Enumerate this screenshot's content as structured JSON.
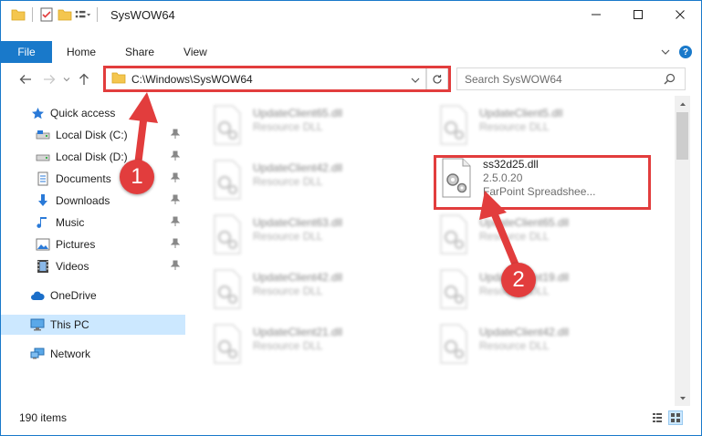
{
  "window": {
    "title": "SysWOW64",
    "controls": {
      "minimize": "─",
      "maximize": "☐",
      "close": "✕"
    }
  },
  "ribbon": {
    "tabs": [
      {
        "label": "File",
        "active": true
      },
      {
        "label": "Home"
      },
      {
        "label": "Share"
      },
      {
        "label": "View"
      }
    ],
    "help_label": "?"
  },
  "addressbar": {
    "path": "C:\\Windows\\SysWOW64",
    "search_placeholder": "Search SysWOW64"
  },
  "navpane": {
    "items": [
      {
        "label": "Quick access",
        "icon": "star-icon",
        "pinned": false
      },
      {
        "label": "Local Disk (C:)",
        "icon": "drive-icon",
        "pinned": true
      },
      {
        "label": "Local Disk (D:)",
        "icon": "drive-icon",
        "pinned": true
      },
      {
        "label": "Documents",
        "icon": "documents-icon",
        "pinned": true
      },
      {
        "label": "Downloads",
        "icon": "downloads-icon",
        "pinned": true
      },
      {
        "label": "Music",
        "icon": "music-icon",
        "pinned": true
      },
      {
        "label": "Pictures",
        "icon": "pictures-icon",
        "pinned": true
      },
      {
        "label": "Videos",
        "icon": "videos-icon",
        "pinned": true
      },
      {
        "label": "OneDrive",
        "icon": "cloud-icon",
        "pinned": false
      },
      {
        "label": "This PC",
        "icon": "computer-icon",
        "pinned": false,
        "selected": true
      },
      {
        "label": "Network",
        "icon": "network-icon",
        "pinned": false
      }
    ]
  },
  "files": [
    {
      "name": "UpdateClient65.dll",
      "type": "Resource DLL",
      "blurred": true
    },
    {
      "name": "UpdateClient5.dll",
      "type": "Resource DLL",
      "blurred": true
    },
    {
      "name": "UpdateClient42.dll",
      "type": "Resource DLL",
      "blurred": true
    },
    {
      "name": "ss32d25.dll",
      "version": "2.5.0.20",
      "type": "FarPoint Spreadshee...",
      "blurred": false,
      "highlighted": true
    },
    {
      "name": "UpdateClient63.dll",
      "type": "Resource DLL",
      "blurred": true
    },
    {
      "name": "UpdateClient65.dll",
      "type": "Resource DLL",
      "blurred": true
    },
    {
      "name": "UpdateClient42.dll",
      "type": "Resource DLL",
      "blurred": true
    },
    {
      "name": "UpdateClient19.dll",
      "type": "Resource DLL",
      "blurred": true
    },
    {
      "name": "UpdateClient21.dll",
      "type": "Resource DLL",
      "blurred": true
    },
    {
      "name": "UpdateClient42.dll",
      "type": "Resource DLL",
      "blurred": true
    }
  ],
  "status": {
    "item_count": "190 items"
  },
  "annotations": {
    "marker1": "1",
    "marker2": "2",
    "color": "#e23d3d"
  },
  "colors": {
    "accent": "#1979ca",
    "selection": "#cce8ff"
  }
}
